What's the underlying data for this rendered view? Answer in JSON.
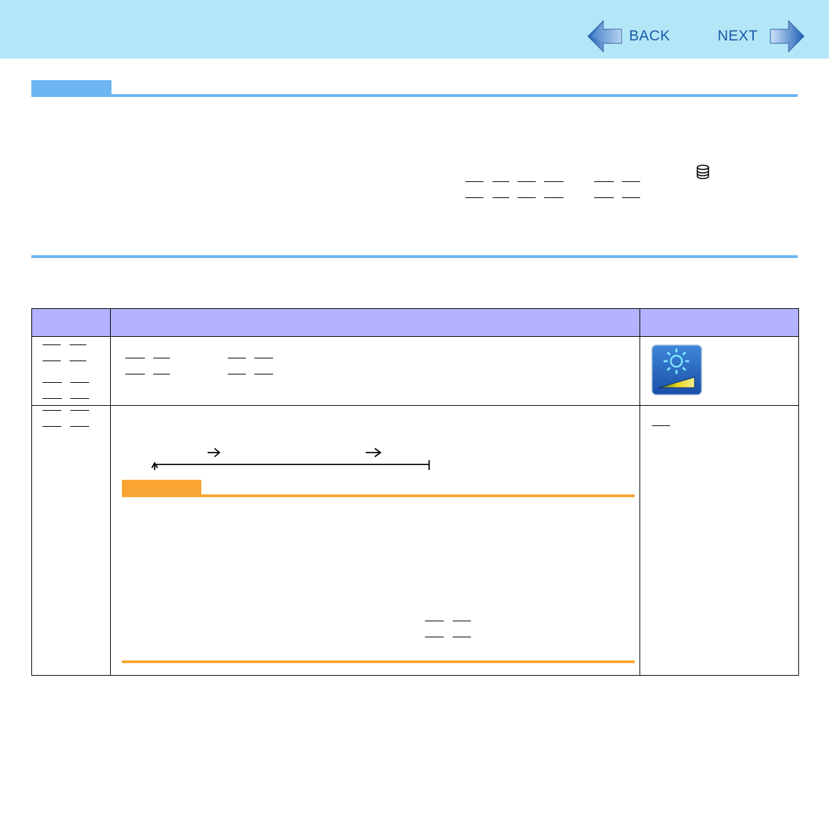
{
  "header": {
    "back_label": "BACK",
    "next_label": "NEXT",
    "background": "#b3e6f6",
    "nav_color": "#1a5aa8"
  },
  "sections": {
    "note_color": "#6cb6f2",
    "caution_color": "#f8a534",
    "table_header_color": "#b3b3ff"
  },
  "icons": {
    "disk": "disk-icon",
    "brightness": "brightness-icon"
  }
}
